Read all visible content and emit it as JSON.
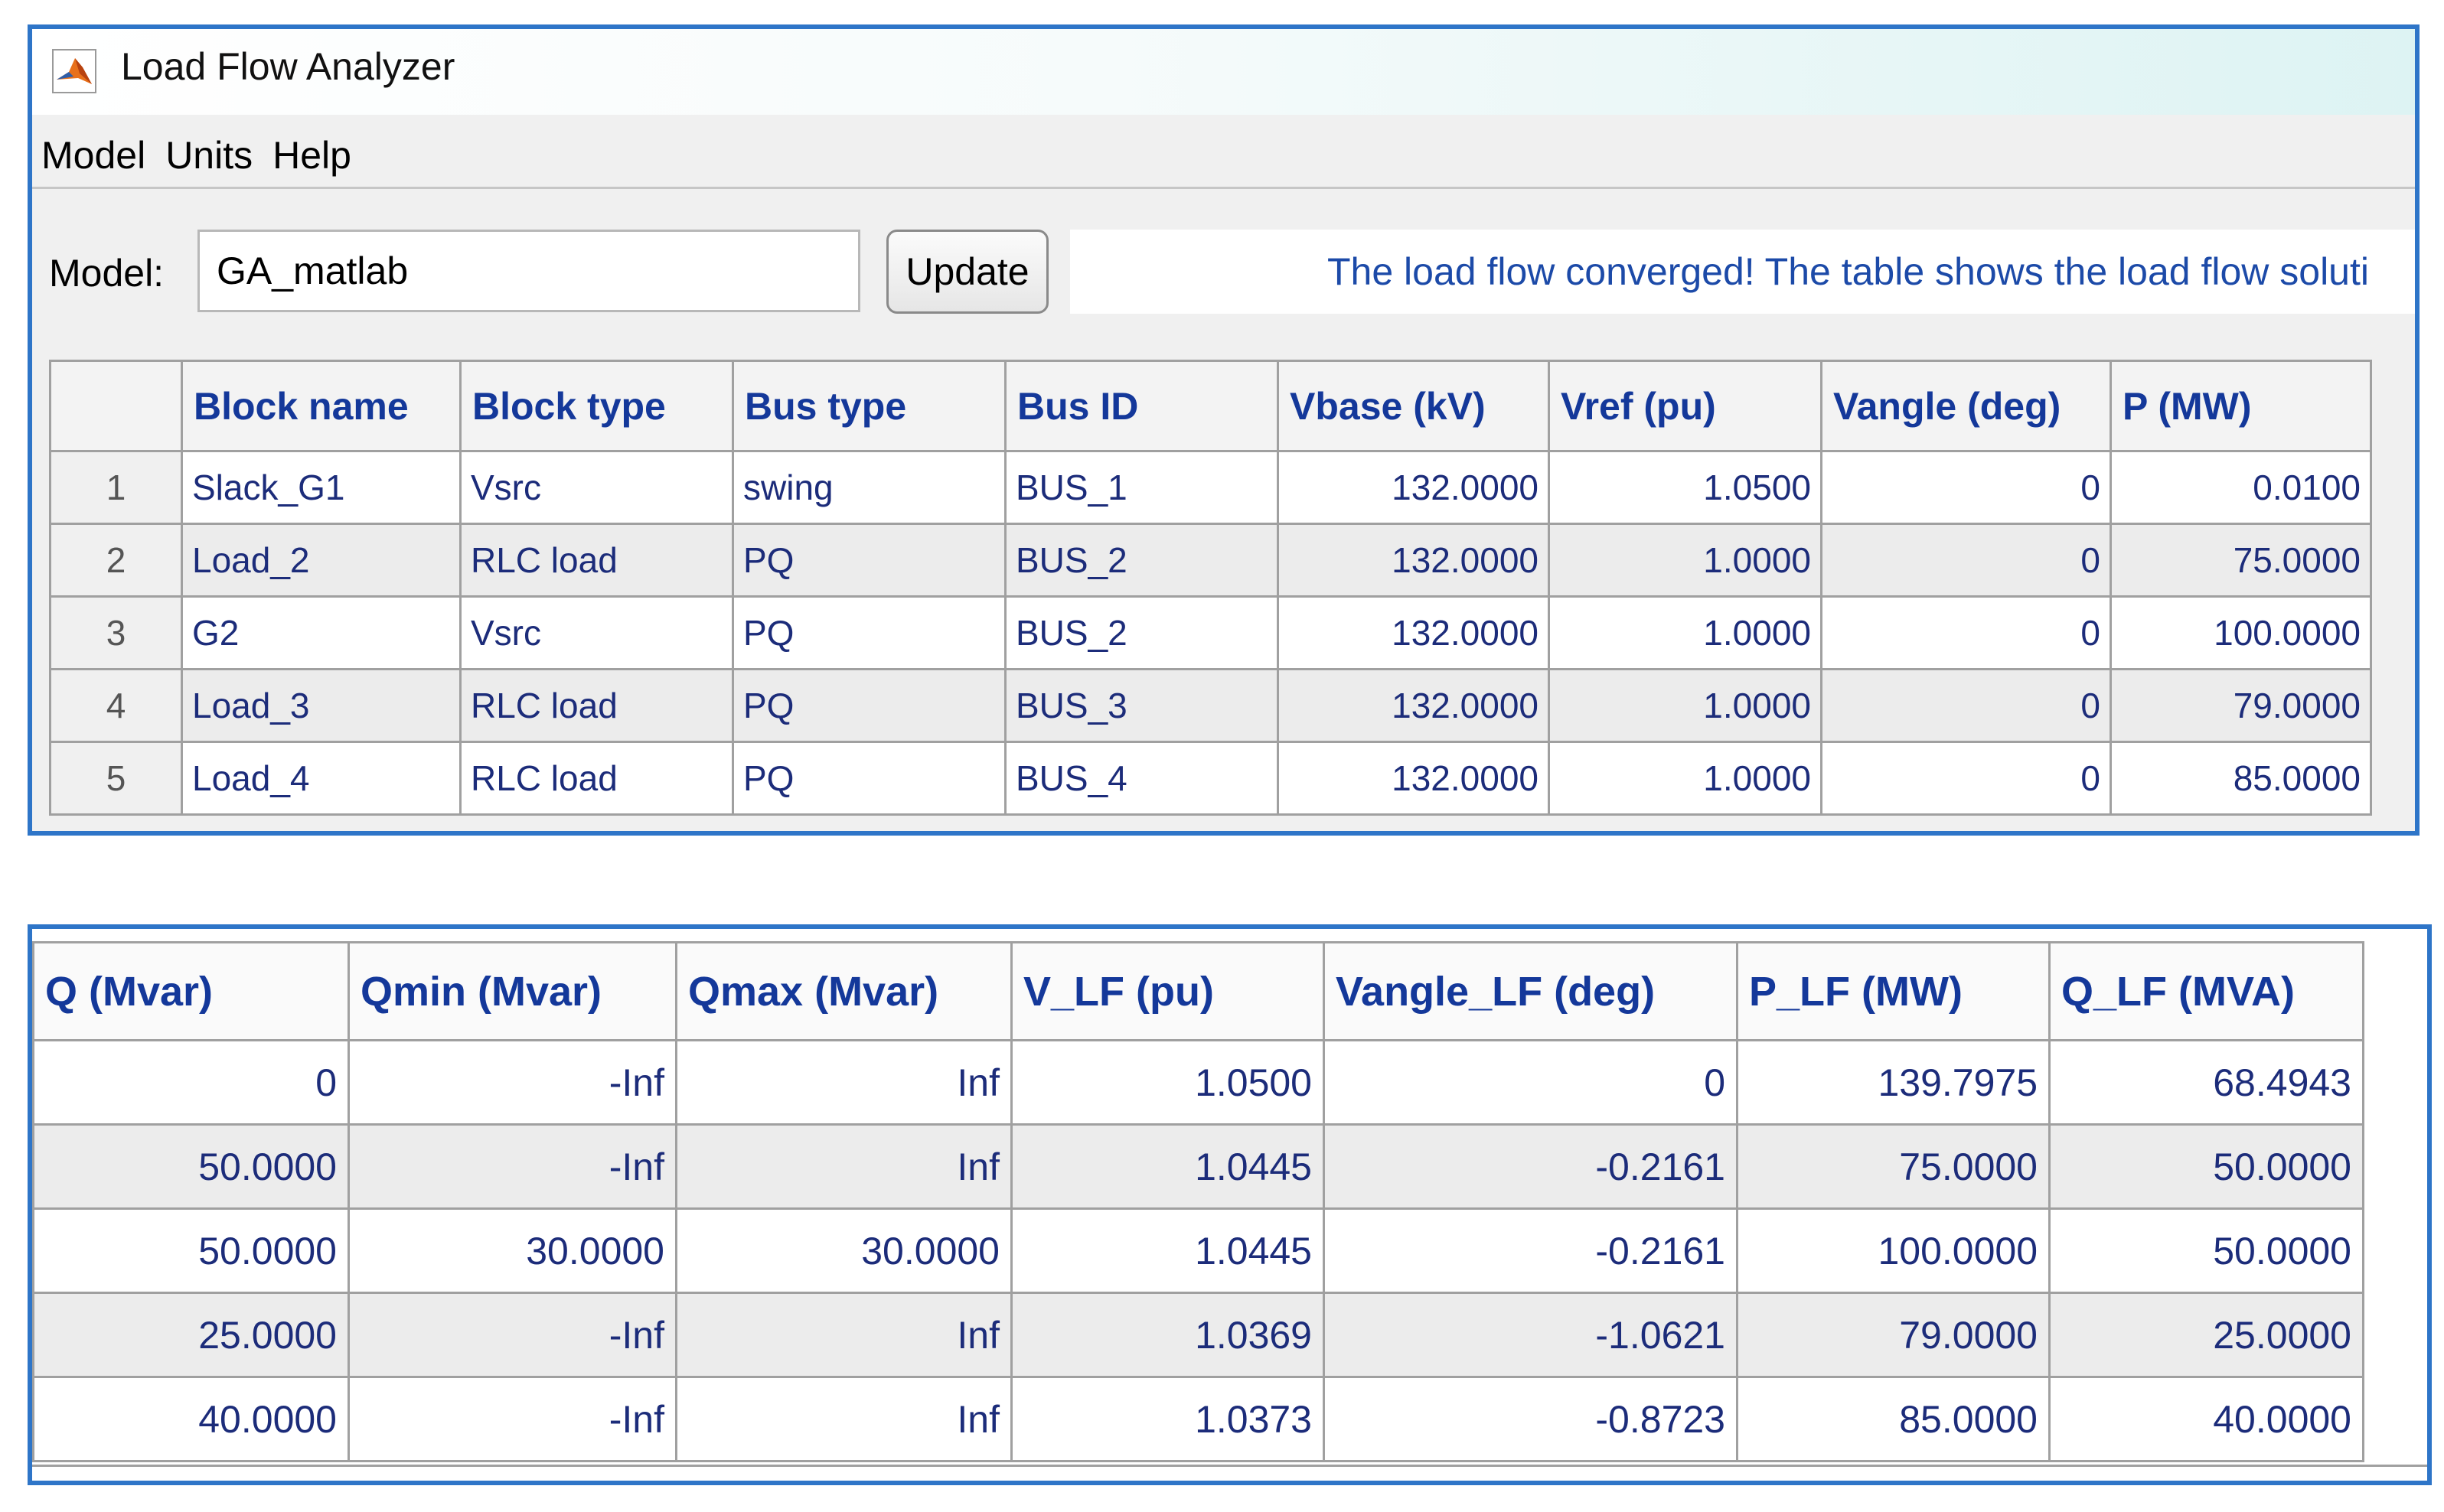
{
  "window": {
    "title": "Load Flow Analyzer"
  },
  "menu": [
    "Model",
    "Units",
    "Help"
  ],
  "model": {
    "label": "Model:",
    "value": "GA_matlab",
    "update_label": "Update"
  },
  "status": "The load flow converged!  The table shows the load flow soluti",
  "top_table": {
    "headers": [
      "Block name",
      "Block type",
      "Bus type",
      "Bus ID",
      "Vbase (kV)",
      "Vref (pu)",
      "Vangle (deg)",
      "P (MW)"
    ],
    "rows": [
      [
        "1",
        "Slack_G1",
        "Vsrc",
        "swing",
        "BUS_1",
        "132.0000",
        "1.0500",
        "0",
        "0.0100"
      ],
      [
        "2",
        "Load_2",
        "RLC load",
        "PQ",
        "BUS_2",
        "132.0000",
        "1.0000",
        "0",
        "75.0000"
      ],
      [
        "3",
        "G2",
        "Vsrc",
        "PQ",
        "BUS_2",
        "132.0000",
        "1.0000",
        "0",
        "100.0000"
      ],
      [
        "4",
        "Load_3",
        "RLC load",
        "PQ",
        "BUS_3",
        "132.0000",
        "1.0000",
        "0",
        "79.0000"
      ],
      [
        "5",
        "Load_4",
        "RLC load",
        "PQ",
        "BUS_4",
        "132.0000",
        "1.0000",
        "0",
        "85.0000"
      ]
    ]
  },
  "bottom_table": {
    "headers": [
      "Q (Mvar)",
      "Qmin (Mvar)",
      "Qmax (Mvar)",
      "V_LF (pu)",
      "Vangle_LF (deg)",
      "P_LF (MW)",
      "Q_LF (MVA)"
    ],
    "rows": [
      [
        "0",
        "-Inf",
        "Inf",
        "1.0500",
        "0",
        "139.7975",
        "68.4943"
      ],
      [
        "50.0000",
        "-Inf",
        "Inf",
        "1.0445",
        "-0.2161",
        "75.0000",
        "50.0000"
      ],
      [
        "50.0000",
        "30.0000",
        "30.0000",
        "1.0445",
        "-0.2161",
        "100.0000",
        "50.0000"
      ],
      [
        "25.0000",
        "-Inf",
        "Inf",
        "1.0369",
        "-1.0621",
        "79.0000",
        "25.0000"
      ],
      [
        "40.0000",
        "-Inf",
        "Inf",
        "1.0373",
        "-0.8723",
        "85.0000",
        "40.0000"
      ]
    ]
  }
}
